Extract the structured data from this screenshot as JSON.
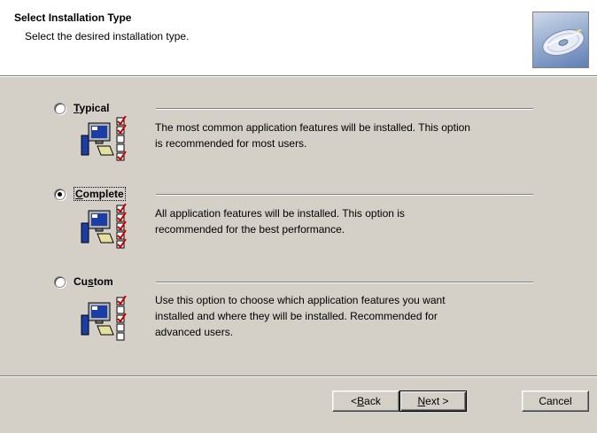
{
  "header": {
    "title": "Select Installation Type",
    "subtitle": "Select the desired installation type.",
    "icon": "cd-disc-icon"
  },
  "options": [
    {
      "key": "T",
      "label_rest": "ypical",
      "selected": false,
      "description_lines": [
        "The most common application features will be installed. This option",
        "is recommended for most users."
      ]
    },
    {
      "key": "C",
      "label_rest": "omplete",
      "selected": true,
      "description_lines": [
        "All application features will be installed. This option is",
        "recommended for the best performance."
      ]
    },
    {
      "key": "s",
      "label_prefix": "Cu",
      "label_rest": "tom",
      "selected": false,
      "description_lines": [
        "Use this option to choose which application features you want",
        "installed and where they will be installed. Recommended for",
        "advanced users."
      ]
    }
  ],
  "buttons": {
    "back_prefix": "< ",
    "back_key": "B",
    "back_rest": "ack",
    "next_key": "N",
    "next_rest": "ext >",
    "cancel": "Cancel"
  },
  "colors": {
    "dialog_bg": "#d4d0c8",
    "header_bg": "#ffffff",
    "check_red": "#cc0000",
    "monitor_blue": "#1a3ea6"
  }
}
